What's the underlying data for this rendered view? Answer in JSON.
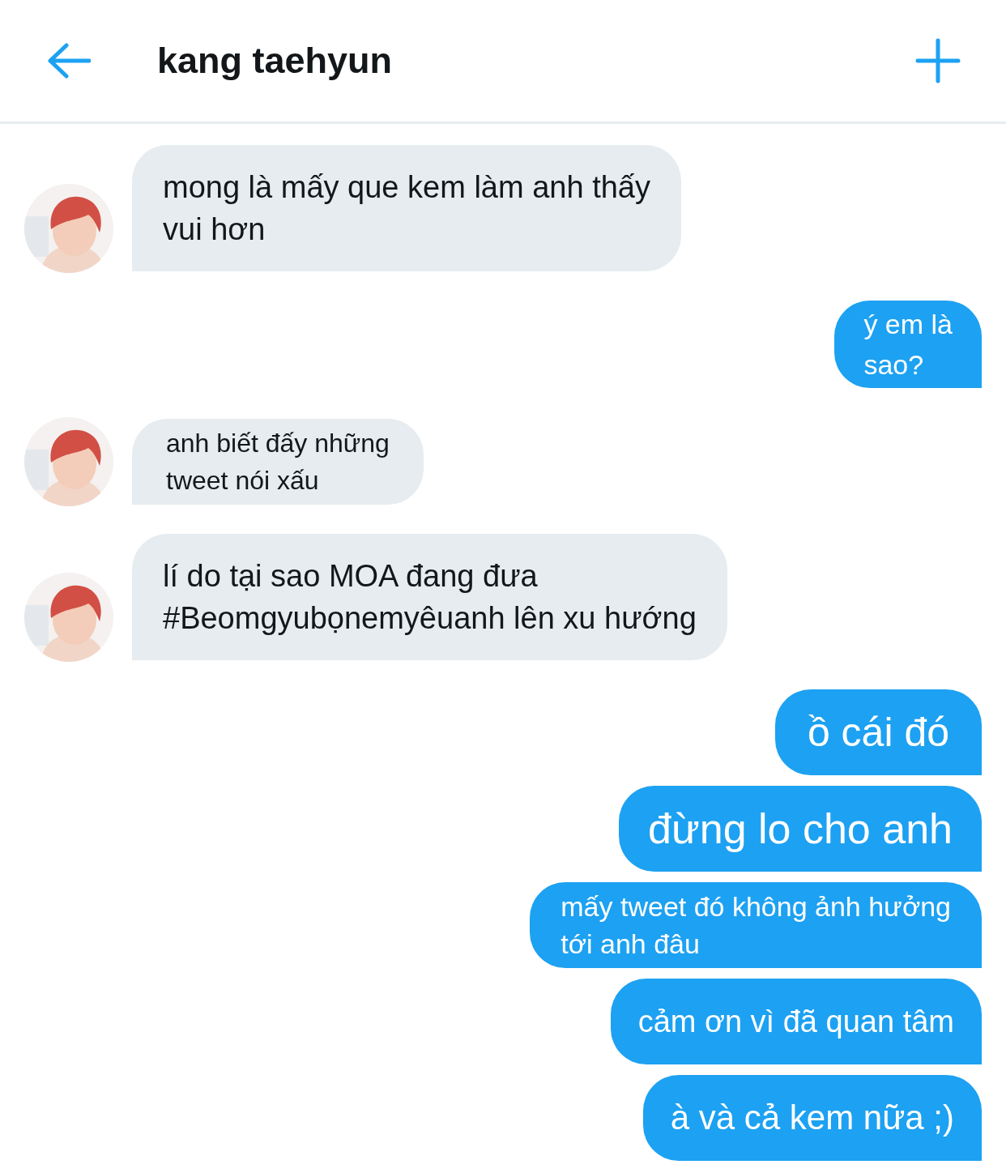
{
  "header": {
    "title": "kang taehyun"
  },
  "messages": [
    {
      "kind": "incoming",
      "text": "mong là mấy que kem làm anh thấy\nvui hơn"
    },
    {
      "kind": "outgoing",
      "text": "ý em là\nsao?"
    },
    {
      "kind": "incoming",
      "text": "anh biết đấy những\ntweet nói xấu"
    },
    {
      "kind": "incoming",
      "text": "lí do tại sao MOA đang đưa\n#Beomgyubọnemyêuanh lên xu hướng"
    },
    {
      "kind": "outgoing",
      "text": "ồ cái đó"
    },
    {
      "kind": "outgoing",
      "text": "đừng lo cho anh"
    },
    {
      "kind": "outgoing",
      "text": "mấy tweet đó không ảnh hưởng\ntới anh đâu"
    },
    {
      "kind": "outgoing",
      "text": "cảm ơn vì đã quan tâm"
    },
    {
      "kind": "outgoing",
      "text": "à và cả kem nữa ;)"
    }
  ]
}
